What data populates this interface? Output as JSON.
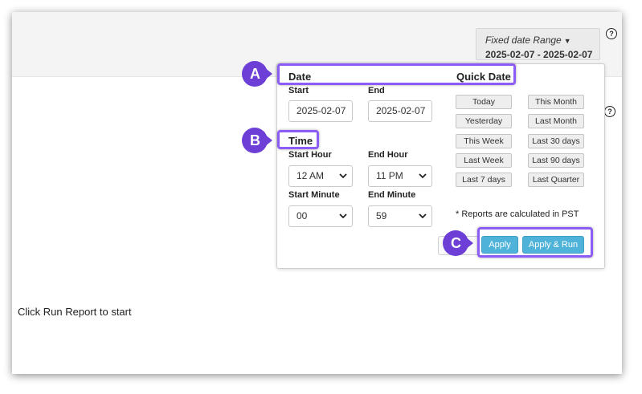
{
  "date_range": {
    "title": "Fixed date Range",
    "value": "2025-02-07 - 2025-02-07"
  },
  "help_glyph": "?",
  "status_text": "Click Run Report to start",
  "panel": {
    "date_header": "Date",
    "quick_date_header": "Quick Date",
    "start_label": "Start",
    "end_label": "End",
    "start_date": "2025-02-07",
    "end_date": "2025-02-07",
    "time_header": "Time",
    "start_hour_label": "Start Hour",
    "end_hour_label": "End Hour",
    "start_hour": "12 AM",
    "end_hour": "11 PM",
    "start_minute_label": "Start Minute",
    "end_minute_label": "End Minute",
    "start_minute": "00",
    "end_minute": "59",
    "quick": [
      [
        "Today",
        "This Month"
      ],
      [
        "Yesterday",
        "Last Month"
      ],
      [
        "This Week",
        "Last 30 days"
      ],
      [
        "Last Week",
        "Last 90 days"
      ],
      [
        "Last 7 days",
        "Last Quarter"
      ]
    ],
    "note": "* Reports are calculated in PST",
    "apply_label": "Apply",
    "apply_run_label": "Apply & Run"
  },
  "callouts": {
    "a": "A",
    "b": "B",
    "c": "C"
  },
  "colors": {
    "highlight": "#8b5cf6",
    "badge": "#6d3fd6",
    "apply_button": "#4fb3d9"
  }
}
